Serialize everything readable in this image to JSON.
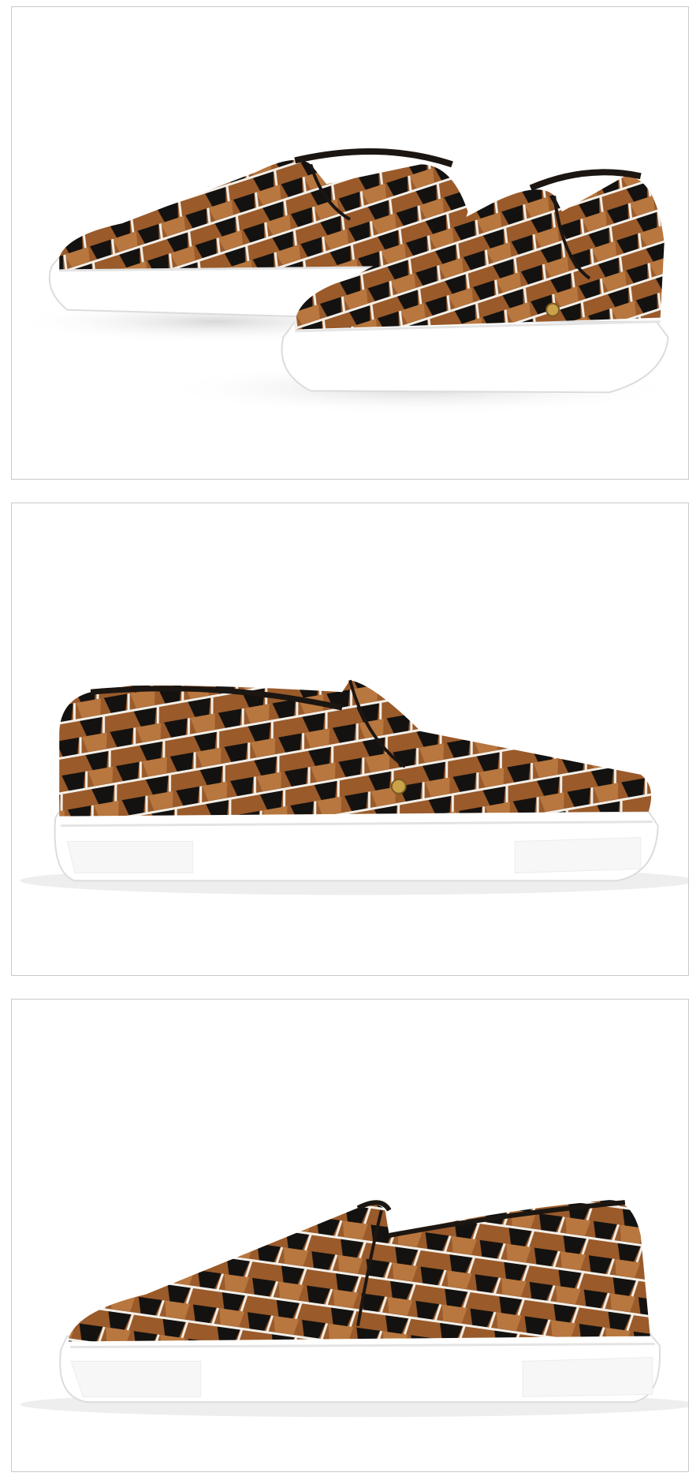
{
  "gallery": {
    "views": [
      {
        "view": "pair-front-three-quarter"
      },
      {
        "view": "single-side-profile-right"
      },
      {
        "view": "single-side-profile-left"
      }
    ]
  },
  "colors": {
    "frame_border": "#c9c9c9",
    "background": "#ffffff",
    "sole": "#ffffff",
    "sole_shadow": "#e4e4e4",
    "pattern_brown": "#9a5a2a",
    "pattern_brown_light": "#b8773f",
    "pattern_black": "#141210",
    "pattern_stripe": "#f3efe8",
    "lining": "#1c1612",
    "stud": "#c9a24a"
  }
}
